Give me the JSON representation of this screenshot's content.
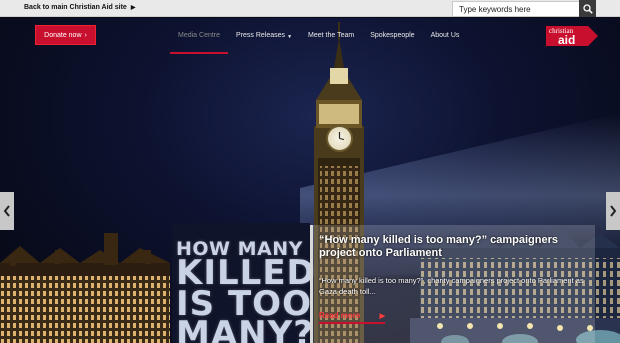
{
  "topbar": {
    "back_link": "Back to main Christian Aid site",
    "search_placeholder": "Type keywords here"
  },
  "nav": {
    "donate_label": "Donate now",
    "items": [
      "Media Centre",
      "Press Releases",
      "Meet the Team",
      "Spokespeople",
      "About Us"
    ],
    "active_index": 0
  },
  "logo": {
    "line1": "christian",
    "line2": "aid"
  },
  "hero": {
    "projection_lines": [
      "HOW MANY",
      "KILLED",
      "IS TOO",
      "MANY?"
    ]
  },
  "card": {
    "title": "“How many killed is too many?” campaigners project onto Parliament",
    "body": "“How many killed is too many?”, charity campaigners project onto Parliament as Gaza death toll...",
    "read_more": "Read more"
  },
  "colors": {
    "accent": "#c8102e",
    "topbar": "#e9e9e9"
  }
}
